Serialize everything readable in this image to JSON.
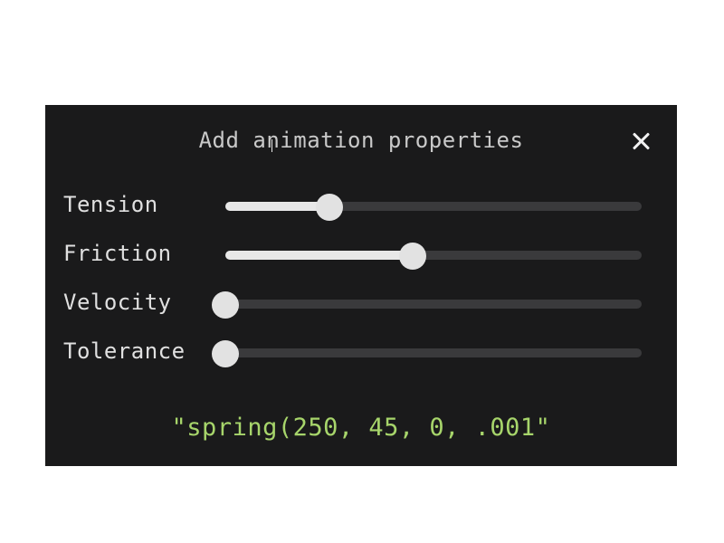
{
  "dialog": {
    "title": "Add animation properties",
    "close_label": "×"
  },
  "sliders": [
    {
      "label": "Tension",
      "value_fraction": 0.25
    },
    {
      "label": "Friction",
      "value_fraction": 0.45
    },
    {
      "label": "Velocity",
      "value_fraction": 0.0
    },
    {
      "label": "Tolerance",
      "value_fraction": 0.0
    }
  ],
  "output": {
    "text": "\"spring(250, 45, 0, .001\""
  },
  "colors": {
    "dialog_background": "#1a1a1b",
    "track": "#3a3a3c",
    "fill": "#e8e8e8",
    "output": "#a7d56b"
  }
}
